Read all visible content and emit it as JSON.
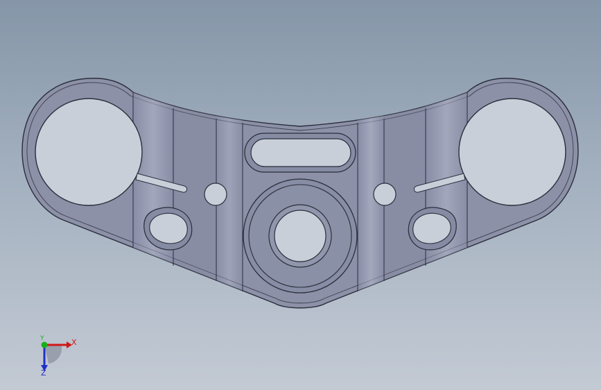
{
  "viewport": {
    "background_top": "#8596a8",
    "background_bottom": "#c3cad4"
  },
  "model": {
    "part": "triple-clamp",
    "face_color": "#8d92a8",
    "edge_color": "#2a2d3a"
  },
  "triad": {
    "x_label": "X",
    "y_label": "Y",
    "z_label": "Z",
    "x_color": "#d01818",
    "y_color": "#18b018",
    "z_color": "#2030c8"
  }
}
